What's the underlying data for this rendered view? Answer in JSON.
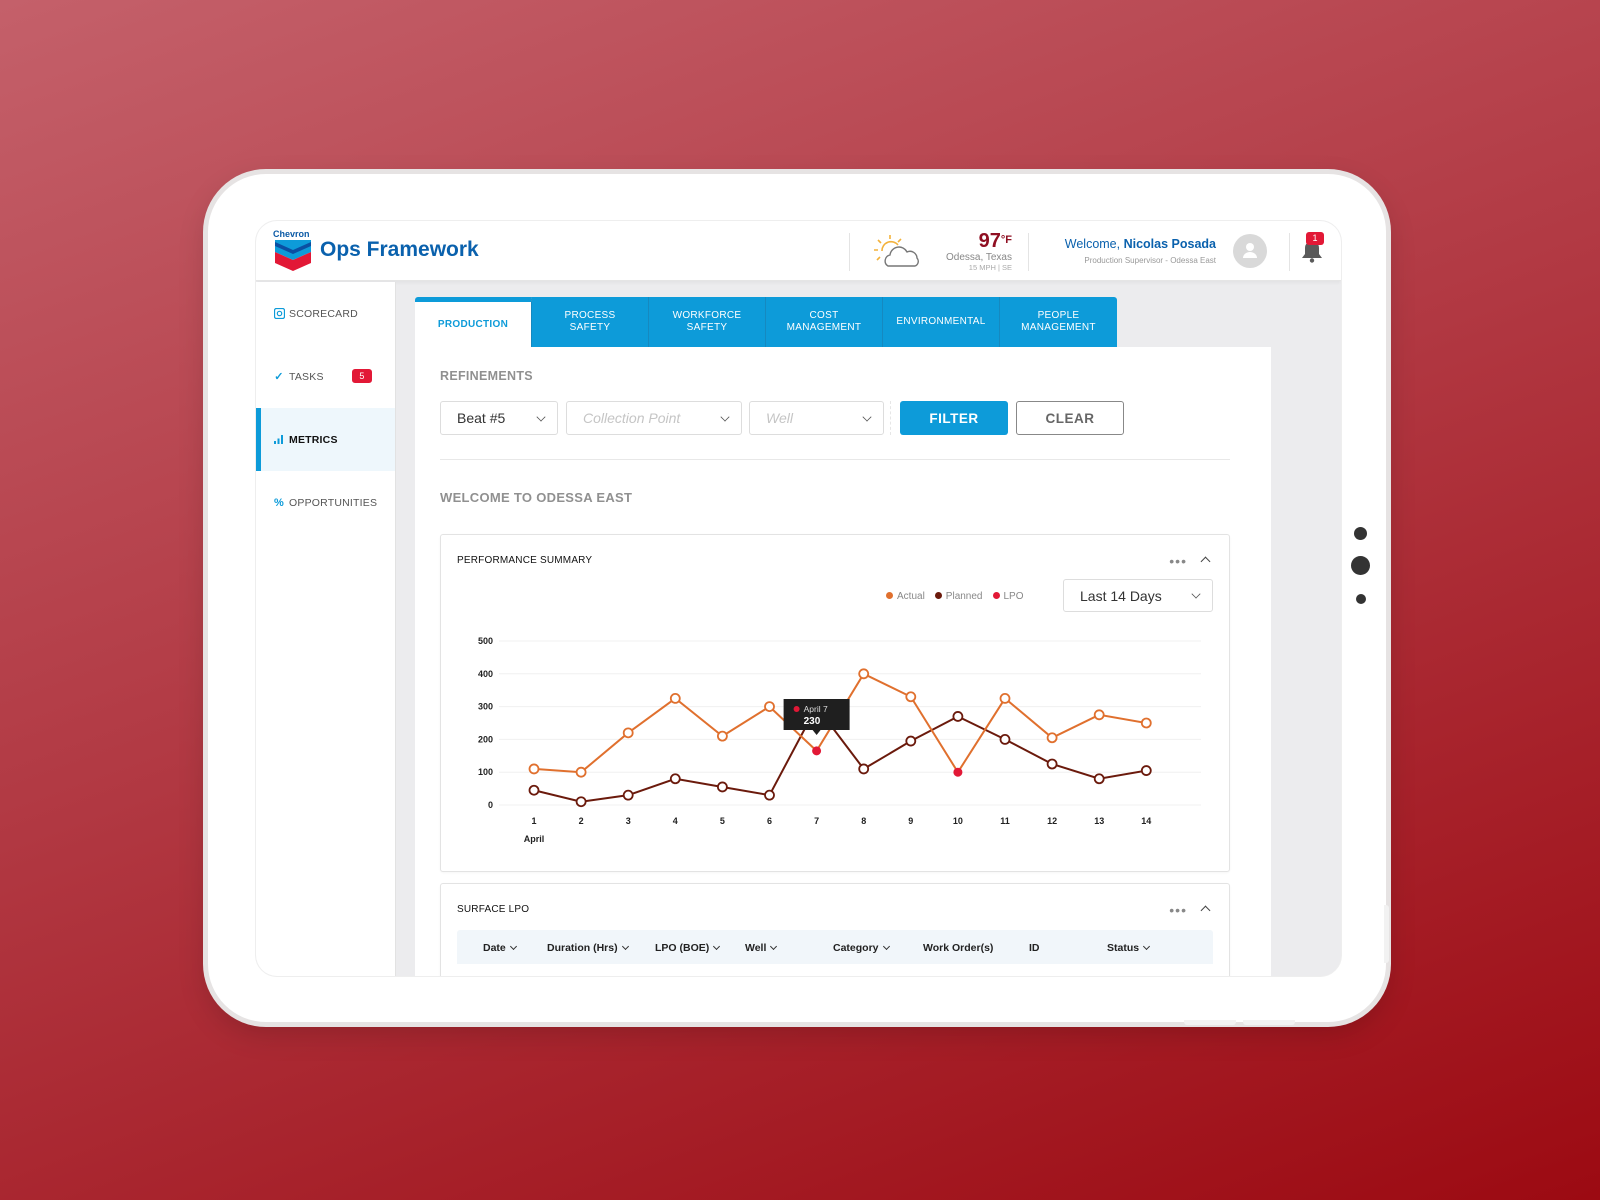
{
  "header": {
    "brand": "Chevron",
    "app_title": "Ops Framework",
    "weather": {
      "icon": "partly-cloudy-icon",
      "temperature": "97",
      "unit": "°F",
      "location": "Odessa, Texas",
      "wind": "15 MPH | SE"
    },
    "user": {
      "welcome_prefix": "Welcome,",
      "name": "Nicolas Posada",
      "role": "Production Supervisor - Odessa  East"
    },
    "notifications_count": "1"
  },
  "sidebar": {
    "items": [
      {
        "label": "SCORECARD",
        "icon": "scorecard-icon",
        "active": false
      },
      {
        "label": "TASKS",
        "icon": "check-icon",
        "badge": "5",
        "active": false
      },
      {
        "label": "METRICS",
        "icon": "bar-chart-icon",
        "active": true
      },
      {
        "label": "OPPORTUNITIES",
        "icon": "percent-icon",
        "active": false
      }
    ]
  },
  "tabs": [
    {
      "label": "PRODUCTION",
      "active": true
    },
    {
      "label": "PROCESS\nSAFETY",
      "active": false
    },
    {
      "label": "WORKFORCE\nSAFETY",
      "active": false
    },
    {
      "label": "COST\nMANAGEMENT",
      "active": false
    },
    {
      "label": "ENVIRONMENTAL",
      "active": false
    },
    {
      "label": "PEOPLE\nMANAGEMENT",
      "active": false
    }
  ],
  "refinements": {
    "title": "REFINEMENTS",
    "beat": {
      "value": "Beat #5"
    },
    "collection_point": {
      "placeholder": "Collection Point"
    },
    "well": {
      "placeholder": "Well"
    },
    "filter_label": "FILTER",
    "clear_label": "CLEAR"
  },
  "welcome_section": "WELCOME TO ODESSA EAST",
  "performance_summary": {
    "title": "PERFORMANCE SUMMARY",
    "range": "Last 14 Days",
    "tooltip": {
      "label": "April 7",
      "value": "230"
    }
  },
  "colors": {
    "actual": "#e0702e",
    "planned": "#6b1a0c",
    "lpo": "#e21836",
    "accent": "#0d9bd9"
  },
  "chart_data": {
    "type": "line",
    "title": "PERFORMANCE SUMMARY",
    "xlabel": "April",
    "ylabel": "",
    "x": [
      1,
      2,
      3,
      4,
      5,
      6,
      7,
      8,
      9,
      10,
      11,
      12,
      13,
      14
    ],
    "ylim": [
      0,
      500
    ],
    "yticks": [
      0,
      100,
      200,
      300,
      400,
      500
    ],
    "grid": true,
    "legend": {
      "position": "top-right",
      "entries": [
        "Actual",
        "Planned",
        "LPO"
      ]
    },
    "series": [
      {
        "name": "Actual",
        "values": [
          110,
          100,
          220,
          325,
          210,
          300,
          165,
          400,
          330,
          100,
          325,
          205,
          275,
          250
        ]
      },
      {
        "name": "Planned",
        "values": [
          45,
          10,
          30,
          80,
          55,
          30,
          300,
          110,
          195,
          270,
          200,
          125,
          80,
          105
        ]
      }
    ],
    "lpo_points": [
      7,
      10
    ],
    "annotations": [
      {
        "x": 7,
        "label": "April 7",
        "value": "230"
      }
    ]
  },
  "surface_lpo": {
    "title": "SURFACE LPO",
    "columns": [
      {
        "label": "Date",
        "sortable": true
      },
      {
        "label": "Duration (Hrs)",
        "sortable": true
      },
      {
        "label": "LPO (BOE)",
        "sortable": true
      },
      {
        "label": "Well",
        "sortable": true
      },
      {
        "label": "Category",
        "sortable": true
      },
      {
        "label": "Work Order(s)",
        "sortable": false
      },
      {
        "label": "ID",
        "sortable": false
      },
      {
        "label": "Status",
        "sortable": true
      }
    ]
  }
}
